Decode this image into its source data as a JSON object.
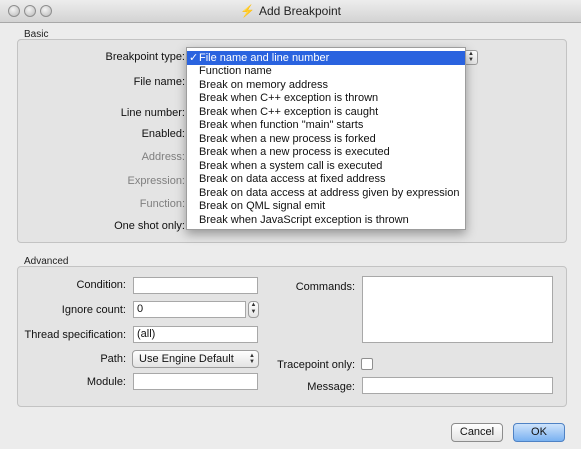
{
  "window": {
    "title": "Add Breakpoint"
  },
  "basic": {
    "group_label": "Basic",
    "breakpoint_type_label": "Breakpoint type:",
    "file_name_label": "File name:",
    "line_number_label": "Line number:",
    "enabled_label": "Enabled:",
    "address_label": "Address:",
    "expression_label": "Expression:",
    "function_label": "Function:",
    "one_shot_label": "One shot only:"
  },
  "type_menu": {
    "check": "✓",
    "items": [
      "File name and line number",
      "Function name",
      "Break on memory address",
      "Break when C++ exception is thrown",
      "Break when C++ exception is caught",
      "Break when function \"main\" starts",
      "Break when a new process is forked",
      "Break when a new process is executed",
      "Break when a system call is executed",
      "Break on data access at fixed address",
      "Break on data access at address given by expression",
      "Break on QML signal emit",
      "Break when JavaScript exception is thrown"
    ]
  },
  "advanced": {
    "group_label": "Advanced",
    "condition_label": "Condition:",
    "condition_value": "",
    "ignore_count_label": "Ignore count:",
    "ignore_count_value": "0",
    "thread_label": "Thread specification:",
    "thread_value": "(all)",
    "path_label": "Path:",
    "path_value": "Use Engine Default",
    "module_label": "Module:",
    "module_value": "",
    "commands_label": "Commands:",
    "tracepoint_label": "Tracepoint only:",
    "message_label": "Message:",
    "message_value": ""
  },
  "buttons": {
    "cancel": "Cancel",
    "ok": "OK"
  }
}
